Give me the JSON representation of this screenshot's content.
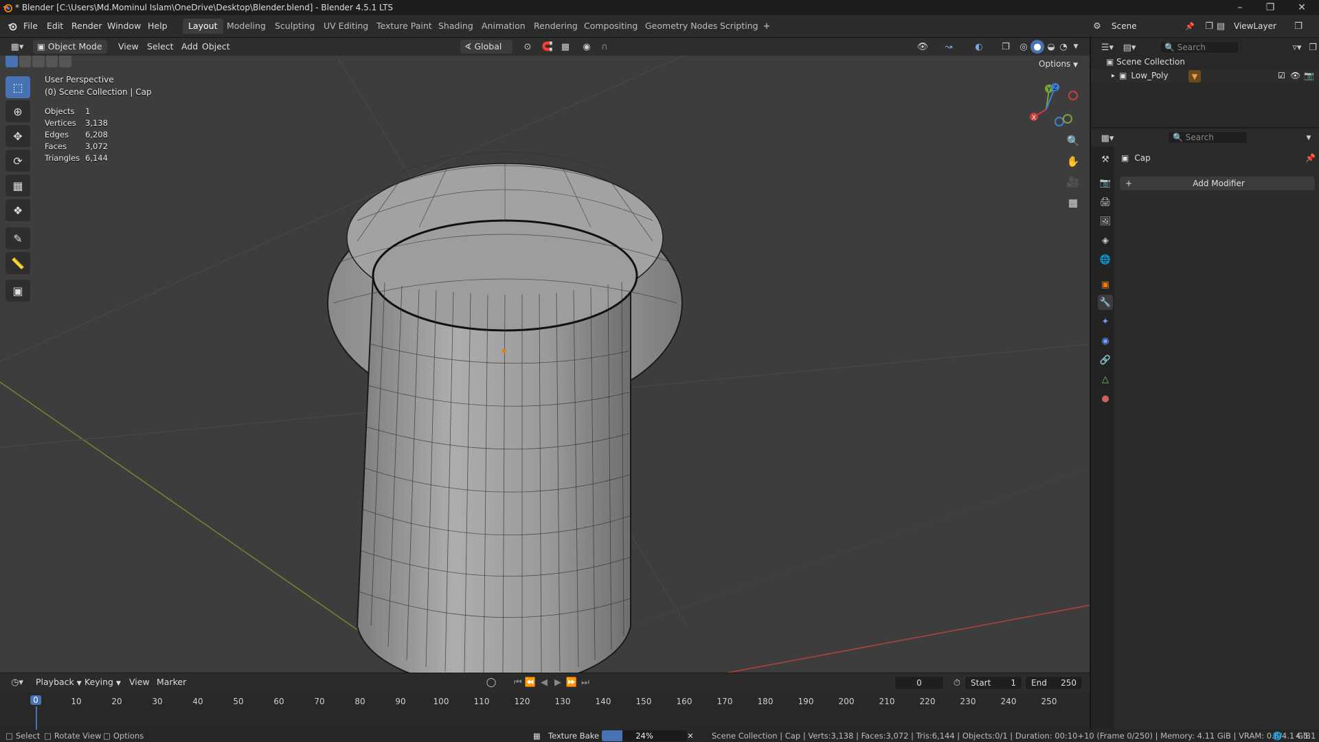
{
  "window": {
    "title": "* Blender [C:\\Users\\Md.Mominul Islam\\OneDrive\\Desktop\\Blender.blend] - Blender 4.5.1 LTS"
  },
  "menu": {
    "items": [
      "File",
      "Edit",
      "Render",
      "Window",
      "Help"
    ]
  },
  "workspaces": [
    "Layout",
    "Modeling",
    "Sculpting",
    "UV Editing",
    "Texture Paint",
    "Shading",
    "Animation",
    "Rendering",
    "Compositing",
    "Geometry Nodes",
    "Scripting"
  ],
  "scene": {
    "name": "Scene",
    "view_layer": "ViewLayer"
  },
  "viewport_header": {
    "mode": "Object Mode",
    "menus": [
      "View",
      "Select",
      "Add",
      "Object"
    ],
    "transform_orientation": "Global",
    "options_label": "Options"
  },
  "viewport": {
    "perspective": "User Perspective",
    "collection_info": "(0) Scene Collection | Cap",
    "stats": [
      {
        "label": "Objects",
        "value": "1"
      },
      {
        "label": "Vertices",
        "value": "3,138"
      },
      {
        "label": "Edges",
        "value": "6,208"
      },
      {
        "label": "Faces",
        "value": "3,072"
      },
      {
        "label": "Triangles",
        "value": "6,144"
      }
    ],
    "gizmo": {
      "x": "X",
      "y": "Y",
      "z": "Z"
    }
  },
  "outliner": {
    "search_placeholder": "Search",
    "root": "Scene Collection",
    "items": [
      {
        "label": "Low_Poly"
      }
    ]
  },
  "properties": {
    "search_placeholder": "Search",
    "object_name": "Cap",
    "add_modifier": "Add Modifier"
  },
  "timeline": {
    "menus": [
      "Playback",
      "Keying",
      "View",
      "Marker"
    ],
    "current_frame": "0",
    "start_label": "Start",
    "start": "1",
    "end_label": "End",
    "end": "250",
    "ticks": [
      "0",
      "10",
      "20",
      "30",
      "40",
      "50",
      "60",
      "70",
      "80",
      "90",
      "100",
      "110",
      "120",
      "130",
      "140",
      "150",
      "160",
      "170",
      "180",
      "190",
      "200",
      "210",
      "220",
      "230",
      "240",
      "250"
    ]
  },
  "statusbar": {
    "select": "Select",
    "rotate": "Rotate View",
    "options": "Options",
    "job": "Texture Bake",
    "progress_label": "24%",
    "progress": 0.24,
    "info": "Scene Collection | Cap | Verts:3,138 | Faces:3,072 | Tris:6,144 | Objects:0/1 | Duration: 00:10+10 (Frame 0/250) | Memory: 4.11 GiB | VRAM: 0.6/4.1 GiB",
    "version": "4.5.1"
  },
  "colors": {
    "accent": "#4772b3",
    "x_axis": "#c8403e",
    "y_axis": "#7aa638",
    "z_axis": "#3f80d6",
    "orange": "#e87d0d"
  }
}
